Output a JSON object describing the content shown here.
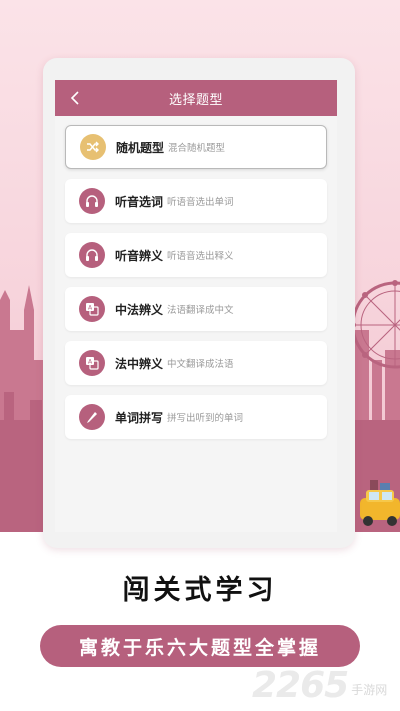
{
  "app": {
    "header": {
      "back_icon": "chevron-left-icon",
      "title": "选择题型"
    },
    "items": [
      {
        "name": "随机题型",
        "desc": "混合随机题型",
        "icon": "shuffle-icon",
        "active": true
      },
      {
        "name": "听音选词",
        "desc": "听语音选出单词",
        "icon": "headphones-icon",
        "active": false
      },
      {
        "name": "听音辨义",
        "desc": "听语音选出释义",
        "icon": "headphones-icon",
        "active": false
      },
      {
        "name": "中法辨义",
        "desc": "法语翻译成中文",
        "icon": "translate-icon",
        "active": false
      },
      {
        "name": "法中辨义",
        "desc": "中文翻译成法语",
        "icon": "translate-icon",
        "active": false
      },
      {
        "name": "单词拼写",
        "desc": "拼写出听到的单词",
        "icon": "pencil-icon",
        "active": false
      }
    ]
  },
  "promo": {
    "headline": "闯关式学习",
    "slogan": "寓教于乐六大题型全掌握"
  },
  "watermark": {
    "number": "2265",
    "site": "手游网"
  },
  "colors": {
    "accent": "#b6607d",
    "active_icon": "#e7c072",
    "background": "#fbe3e8"
  }
}
